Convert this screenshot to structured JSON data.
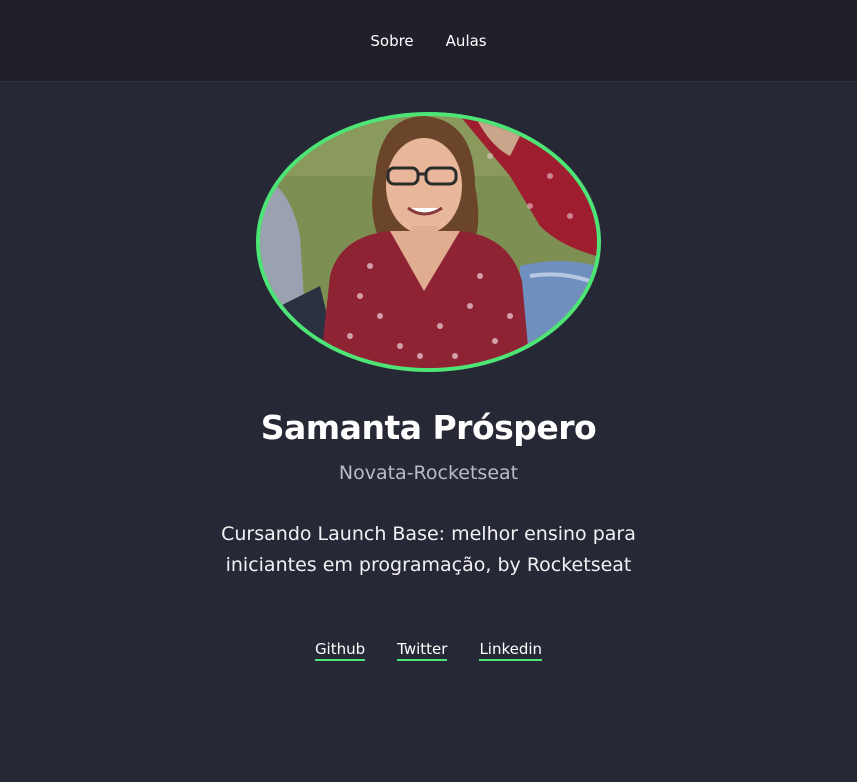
{
  "nav": {
    "items": [
      {
        "label": "Sobre"
      },
      {
        "label": "Aulas"
      }
    ]
  },
  "profile": {
    "name": "Samanta Próspero",
    "role": "Novata-Rocketseat",
    "bio": "Cursando Launch Base: melhor ensino para iniciantes em programação, by Rocketseat",
    "avatar_icon": "profile-photo",
    "accent_color": "#4ee577"
  },
  "social": {
    "links": [
      {
        "label": "Github"
      },
      {
        "label": "Twitter"
      },
      {
        "label": "Linkedin"
      }
    ]
  },
  "colors": {
    "background": "#262835",
    "header": "#1f2029",
    "accent": "#4ee577"
  }
}
